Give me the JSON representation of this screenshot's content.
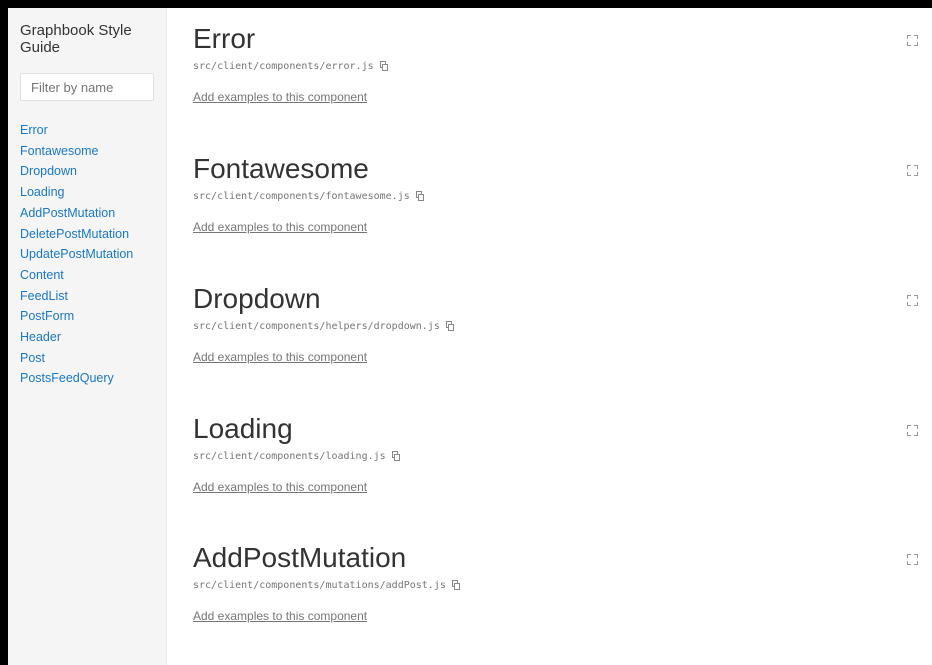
{
  "sidebar": {
    "title": "Graphbook Style Guide",
    "filter_placeholder": "Filter by name",
    "items": [
      {
        "label": "Error"
      },
      {
        "label": "Fontawesome"
      },
      {
        "label": "Dropdown"
      },
      {
        "label": "Loading"
      },
      {
        "label": "AddPostMutation"
      },
      {
        "label": "DeletePostMutation"
      },
      {
        "label": "UpdatePostMutation"
      },
      {
        "label": "Content"
      },
      {
        "label": "FeedList"
      },
      {
        "label": "PostForm"
      },
      {
        "label": "Header"
      },
      {
        "label": "Post"
      },
      {
        "label": "PostsFeedQuery"
      }
    ]
  },
  "main": {
    "sections": [
      {
        "title": "Error",
        "path": "src/client/components/error.js",
        "add_link": "Add examples to this component"
      },
      {
        "title": "Fontawesome",
        "path": "src/client/components/fontawesome.js",
        "add_link": "Add examples to this component"
      },
      {
        "title": "Dropdown",
        "path": "src/client/components/helpers/dropdown.js",
        "add_link": "Add examples to this component"
      },
      {
        "title": "Loading",
        "path": "src/client/components/loading.js",
        "add_link": "Add examples to this component"
      },
      {
        "title": "AddPostMutation",
        "path": "src/client/components/mutations/addPost.js",
        "add_link": "Add examples to this component"
      }
    ]
  },
  "colors": {
    "link": "#1978c8",
    "heading": "#333333",
    "muted": "#767676",
    "sidebar_bg": "#f5f5f5"
  },
  "icons": {
    "copy": "copy-icon",
    "expand": "expand-icon"
  }
}
